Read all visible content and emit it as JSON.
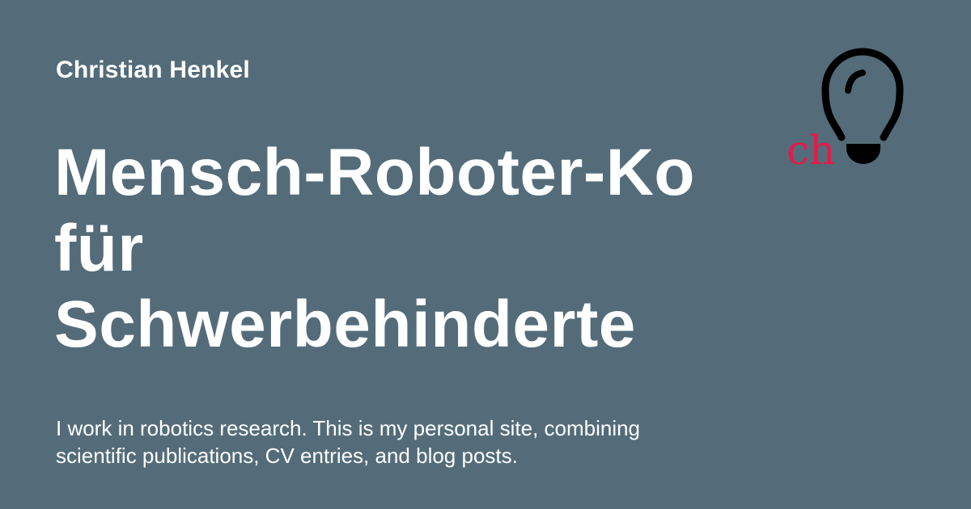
{
  "author": "Christian Henkel",
  "title_lines": [
    "Mensch-Roboter-Ko",
    "für",
    "Schwerbehinderte"
  ],
  "description": "I work in robotics research. This is my personal site, combining scientific publications, CV entries, and blog posts.",
  "logo": {
    "text": "ch",
    "icon": "lightbulb-icon",
    "text_color": "#e8194a"
  },
  "colors": {
    "background": "#546c79",
    "text": "#ffffff"
  }
}
